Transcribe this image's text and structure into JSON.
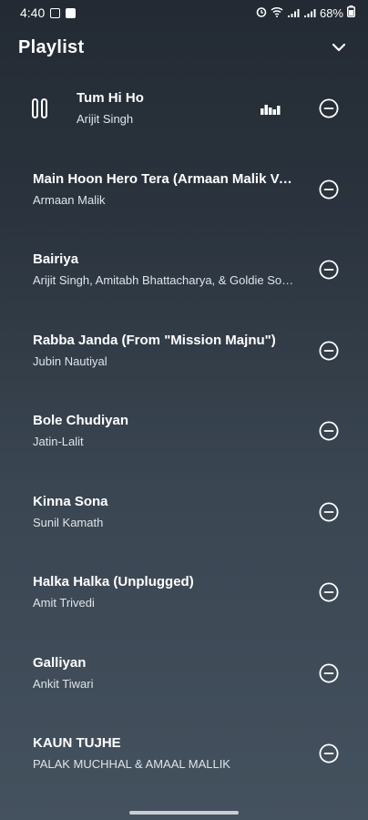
{
  "status_bar": {
    "time": "4:40",
    "battery": "68%",
    "icons": [
      "gallery-icon",
      "app-icon",
      "alarm-icon",
      "wifi-icon",
      "signal-icon",
      "signal-icon",
      "battery-icon"
    ]
  },
  "header": {
    "title": "Playlist"
  },
  "songs": [
    {
      "title": "Tum Hi Ho",
      "artist": "Arijit Singh"
    },
    {
      "title": "Main Hoon Hero Tera (Armaan Malik Version)",
      "artist": "Armaan Malik"
    },
    {
      "title": "Bairiya",
      "artist": "Arijit Singh, Amitabh Bhattacharya, & Goldie Sohel"
    },
    {
      "title": "Rabba Janda (From \"Mission Majnu\")",
      "artist": "Jubin Nautiyal"
    },
    {
      "title": "Bole Chudiyan",
      "artist": "Jatin-Lalit"
    },
    {
      "title": "Kinna Sona",
      "artist": "Sunil Kamath"
    },
    {
      "title": "Halka Halka (Unplugged)",
      "artist": "Amit Trivedi"
    },
    {
      "title": "Galliyan",
      "artist": "Ankit Tiwari"
    },
    {
      "title": "KAUN TUJHE",
      "artist": "PALAK MUCHHAL & AMAAL MALLIK"
    }
  ],
  "colors": {
    "text": "#ffffff",
    "subtext": "#dfe4ea",
    "bg_top": "#232a33",
    "bg_bottom": "#44515e"
  }
}
